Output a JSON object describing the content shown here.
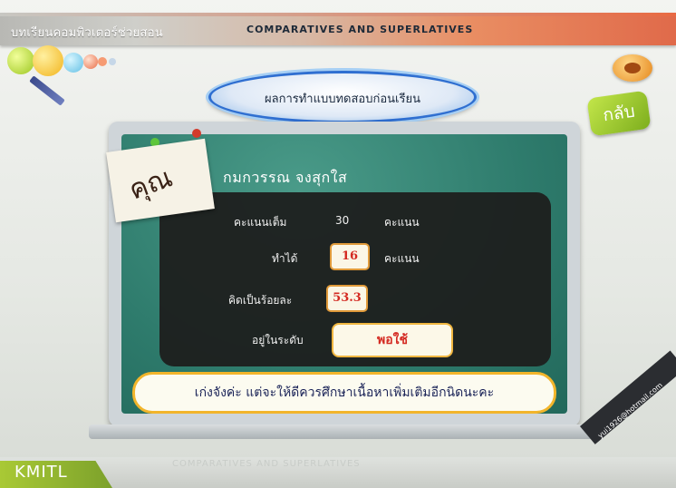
{
  "header": {
    "app_title": "บทเรียนคอมพิวเตอร์ช่วยสอน",
    "lesson_title": "COMPARATIVES AND SUPERLATIVES"
  },
  "result_title": "ผลการทำแบบทดสอบก่อนเรียน",
  "back_label": "กลับ",
  "note_label": "คุณ",
  "student_name": "กมกวรรณ จงสุกใส",
  "stats": {
    "full_label": "คะแนนเต็ม",
    "full_value": "30",
    "full_unit": "คะแนน",
    "got_label": "ทำได้",
    "got_value": "16",
    "got_unit": "คะแนน",
    "percent_label": "คิดเป็นร้อยละ",
    "percent_value": "53.3"
  },
  "level": {
    "label": "อยู่ในระดับ",
    "value": "พอใช้"
  },
  "advice": "เก่งจังค่ะ แต่จะให้ดีควรศึกษาเนื้อหาเพิ่มเติมอีกนิดนะคะ",
  "footer": {
    "brand": "KMITL",
    "subtitle": "COMPARATIVES AND SUPERLATIVES",
    "email": "yui1926@hotmail.com"
  },
  "colors": {
    "accent_orange": "#e06a4a",
    "board_green": "#2e7b6c",
    "value_red": "#d42a22",
    "advice_border": "#f2b52b",
    "brand_green": "#a9c935"
  }
}
